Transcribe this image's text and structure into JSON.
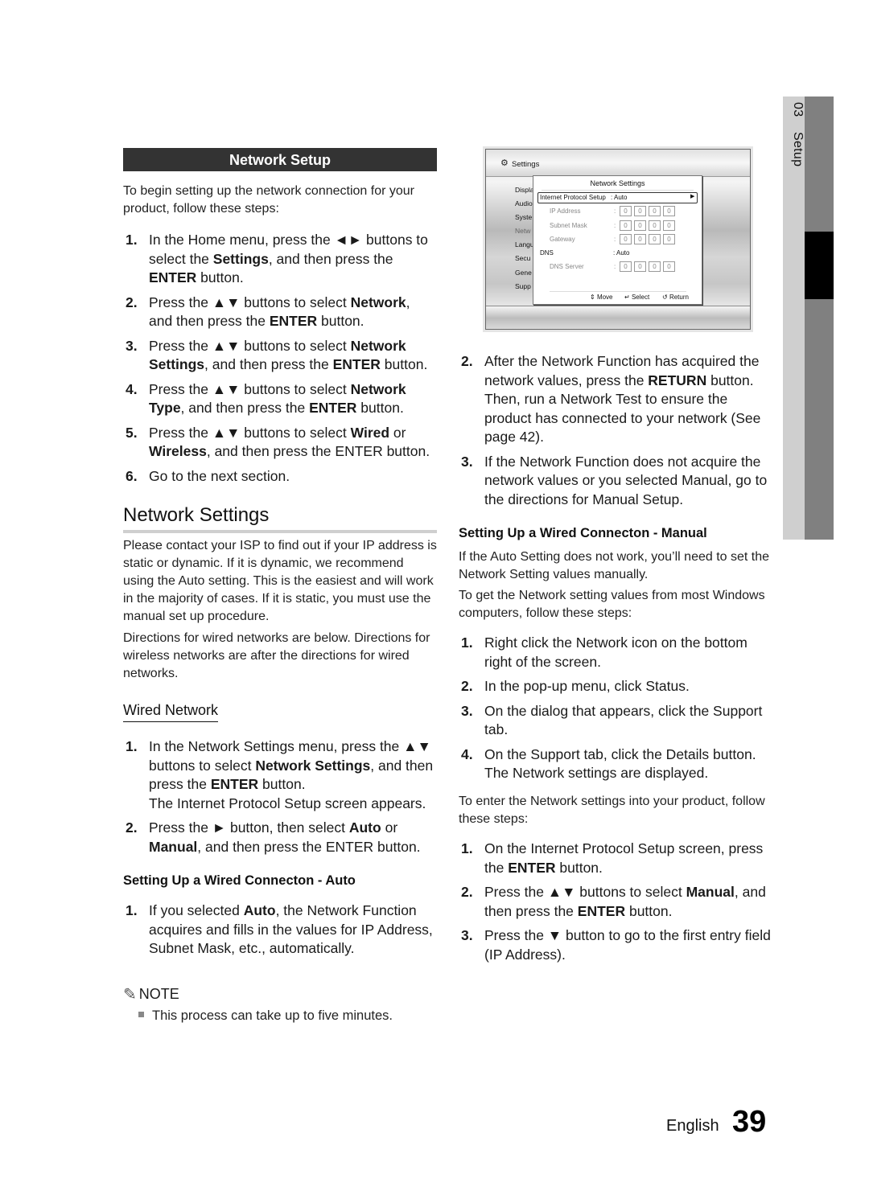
{
  "side_tab": {
    "chapter": "03",
    "label": "Setup"
  },
  "left": {
    "section_header": "Network Setup",
    "intro": "To begin setting up the network connection for your product, follow these steps:",
    "setup_steps": [
      {
        "num": "1.",
        "pre": "In the Home menu, press the ◄► buttons to select the ",
        "b1": "Settings",
        "mid": ", and then press the ",
        "b2": "ENTER",
        "post": " button."
      },
      {
        "num": "2.",
        "pre": "Press the ▲▼ buttons to select ",
        "b1": "Network",
        "mid": ", and then press the ",
        "b2": "ENTER",
        "post": " button."
      },
      {
        "num": "3.",
        "pre": "Press the ▲▼ buttons to select ",
        "b1": "Network Settings",
        "mid": ", and then press the ",
        "b2": "ENTER",
        "post": " button."
      },
      {
        "num": "4.",
        "pre": "Press the ▲▼ buttons to select ",
        "b1": "Network Type",
        "mid": ", and then press the ",
        "b2": "ENTER",
        "post": " button."
      },
      {
        "num": "5.",
        "pre": "Press the ▲▼ buttons to select ",
        "b1": "Wired",
        "mid": " or ",
        "b2": "Wireless",
        "post": ", and then press the ENTER button."
      },
      {
        "num": "6.",
        "pre": "Go to the next section.",
        "b1": "",
        "mid": "",
        "b2": "",
        "post": ""
      }
    ],
    "network_settings_title": "Network Settings",
    "ns_para1": "Please contact your ISP to find out if your IP address is static or dynamic. If it is dynamic, we recommend using the Auto setting. This is the easiest and will work in the majority of cases. If it is static, you must use the manual set up procedure.",
    "ns_para2": "Directions for wired networks are below. Directions for wireless networks are after the directions for wired networks.",
    "wired_title": "Wired Network",
    "wired_steps": [
      {
        "num": "1.",
        "pre": "In the Network Settings menu, press the ▲▼ buttons to select ",
        "b1": "Network Settings",
        "mid": ", and then press the ",
        "b2": "ENTER",
        "post": " button.",
        "note": "The Internet Protocol Setup screen appears."
      },
      {
        "num": "2.",
        "pre": "Press the ► button, then select ",
        "b1": "Auto",
        "mid": " or ",
        "b2": "Manual",
        "post": ", and then press the ENTER button.",
        "note": ""
      }
    ],
    "auto_title": "Setting Up a Wired Connecton - Auto",
    "auto_steps": [
      {
        "num": "1.",
        "pre": "If you selected ",
        "b1": "Auto",
        "post": ", the Network Function acquires and fills in the values for IP Address, Subnet Mask, etc., automatically."
      }
    ],
    "note_label": "NOTE",
    "note_text": "This process can take up to five minutes."
  },
  "screen": {
    "header": "Settings",
    "menu": [
      "Displa",
      "Audio",
      "Syste",
      "Netw",
      "Langu",
      "Secu",
      "Gene",
      "Supp"
    ],
    "popup_title": "Network Settings",
    "rows": [
      {
        "label": "Internet Protocol Setup",
        "value": ": Auto"
      },
      {
        "label": "IP Address",
        "octets": [
          "0",
          "0",
          "0",
          "0"
        ]
      },
      {
        "label": "Subnet Mask",
        "octets": [
          "0",
          "0",
          "0",
          "0"
        ]
      },
      {
        "label": "Gateway",
        "octets": [
          "0",
          "0",
          "0",
          "0"
        ]
      },
      {
        "label": "DNS",
        "value": ": Auto"
      },
      {
        "label": "DNS Server",
        "octets": [
          "0",
          "0",
          "0",
          "0"
        ]
      }
    ],
    "footer": {
      "move": "Move",
      "select": "Select",
      "return": "Return"
    }
  },
  "right": {
    "steps_a": [
      {
        "num": "2.",
        "pre": "After the Network Function has acquired the network values, press the ",
        "b1": "RETURN",
        "post": " button. Then, run a Network Test to ensure the product has connected to your network (See page 42)."
      },
      {
        "num": "3.",
        "pre": "If the Network Function does not acquire the network values or you selected Manual, go to the directions for Manual Setup.",
        "b1": "",
        "post": ""
      }
    ],
    "manual_title": "Setting Up a Wired Connecton - Manual",
    "manual_p1": "If the Auto Setting does not work, you’ll need to set the Network Setting values manually.",
    "manual_p2": "To get the Network setting values from most Windows computers, follow these steps:",
    "win_steps": [
      {
        "num": "1.",
        "text": "Right click the Network icon on the bottom right of the screen."
      },
      {
        "num": "2.",
        "text": "In the pop-up menu, click Status."
      },
      {
        "num": "3.",
        "text": "On the dialog that appears, click the Support tab."
      },
      {
        "num": "4.",
        "text": "On the Support tab, click the Details button. The Network settings are displayed."
      }
    ],
    "enter_intro": "To enter the Network settings into your product, follow these steps:",
    "enter_steps": [
      {
        "num": "1.",
        "pre": "On the Internet Protocol Setup screen, press the ",
        "b1": "ENTER",
        "mid": " button.",
        "b2": "",
        "post": ""
      },
      {
        "num": "2.",
        "pre": "Press the ▲▼ buttons to select ",
        "b1": "Manual",
        "mid": ", and then press the ",
        "b2": "ENTER",
        "post": " button."
      },
      {
        "num": "3.",
        "pre": "Press the ▼ button to go to the first entry field (IP Address).",
        "b1": "",
        "mid": "",
        "b2": "",
        "post": ""
      }
    ]
  },
  "footer": {
    "language": "English",
    "page_number": "39"
  }
}
